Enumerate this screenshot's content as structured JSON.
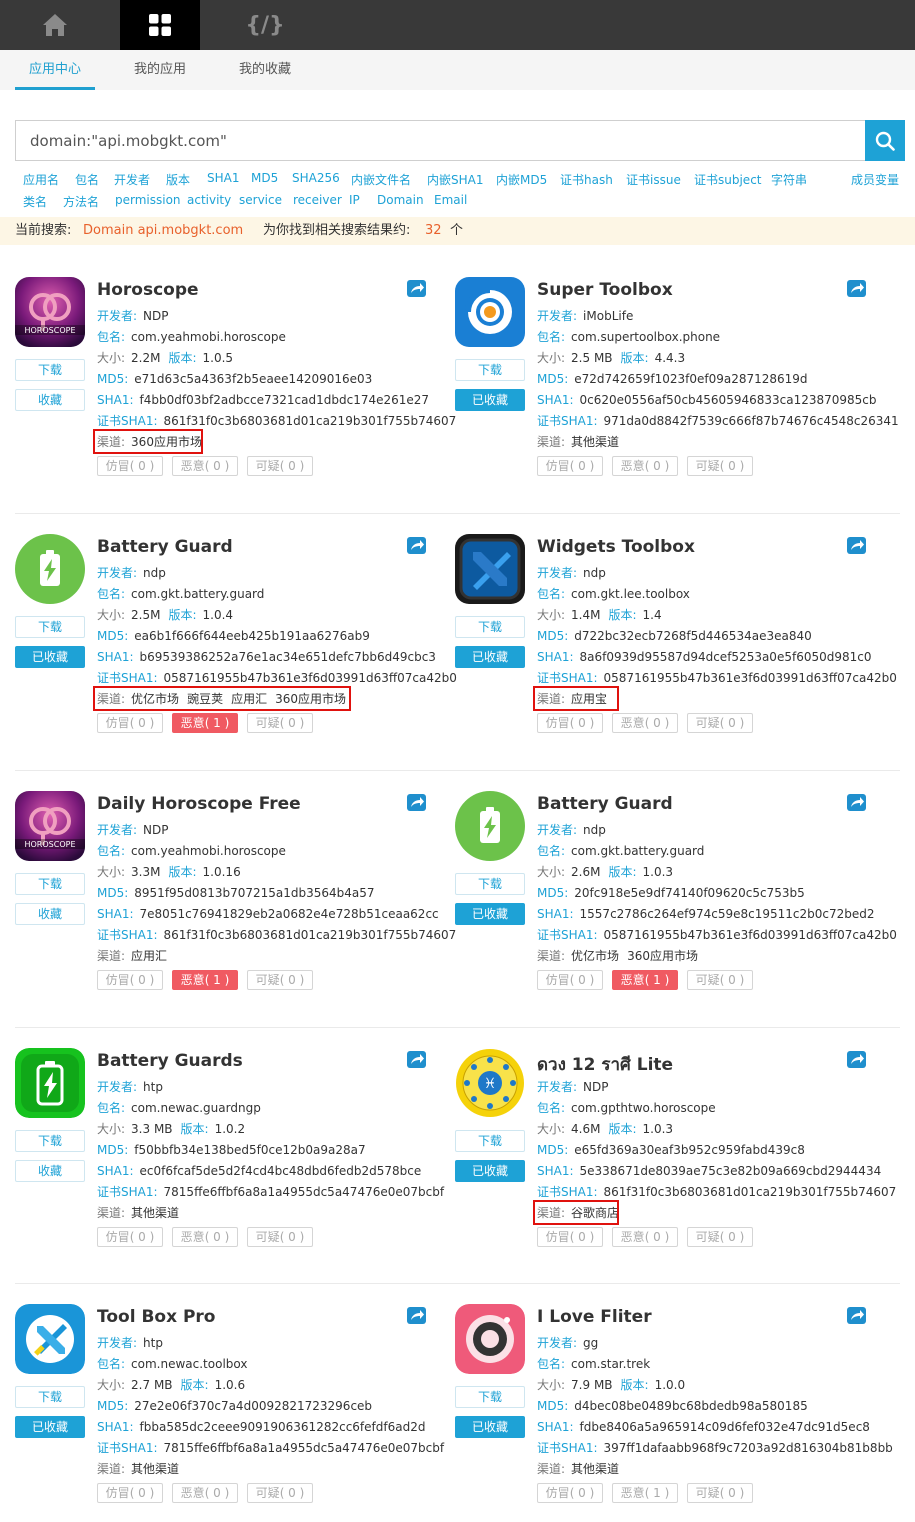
{
  "topbar": {
    "items": [
      {
        "name": "home-icon"
      },
      {
        "name": "grid-icon"
      },
      {
        "name": "code-icon",
        "glyph": "{/}"
      }
    ]
  },
  "tabs": [
    {
      "label": "应用中心",
      "active": true
    },
    {
      "label": "我的应用"
    },
    {
      "label": "我的收藏"
    }
  ],
  "search": {
    "value": "domain:\"api.mobgkt.com\"",
    "button_icon": "search-icon"
  },
  "filters_row1": [
    "应用名",
    "包名",
    "开发者",
    "版本",
    "SHA1",
    "MD5",
    "SHA256",
    "内嵌文件名",
    "内嵌SHA1",
    "内嵌MD5",
    "证书hash",
    "证书issue",
    "证书subject",
    "字符串",
    "成员变量"
  ],
  "filters_row2": [
    "类名",
    "方法名",
    "permission",
    "activity",
    "service",
    "receiver",
    "IP",
    "Domain",
    "Email"
  ],
  "result": {
    "label": "当前搜索:",
    "query": "Domain api.mobgkt.com",
    "text": "为你找到相关搜索结果约:",
    "count": "32",
    "unit": "个"
  },
  "labels": {
    "developer": "开发者:",
    "package": "包名:",
    "size": "大小:",
    "version": "版本:",
    "md5": "MD5:",
    "sha1": "SHA1:",
    "cert_sha1": "证书SHA1:",
    "channel": "渠道:",
    "download": "下载",
    "favorite": "收藏",
    "favorited": "已收藏",
    "rate_fake": "仿冒",
    "rate_malicious": "恶意",
    "rate_suspicious": "可疑"
  },
  "colors": {
    "accent": "#1ea2d6",
    "warning": "#e8612c",
    "danger": "#f05a62",
    "highlight": "#e0120e"
  },
  "apps": [
    {
      "name": "Horoscope",
      "icon": "horoscope-app-icon",
      "developer": "NDP",
      "package": "com.yeahmobi.horoscope",
      "size": "2.2M",
      "version": "1.0.5",
      "md5": "e71d63c5a4363f2b5eaee14209016e03",
      "sha1": "f4bb0df03bf2adbcce7321cad1dbdc174e261e27",
      "cert_sha1": "861f31f0c3b6803681d01ca219b301f755b74607",
      "channels": [
        "360应用市场"
      ],
      "favorited": false,
      "ratings": [
        "( 0 )",
        "( 0 )",
        "( 0 )"
      ],
      "malicious_flag": false,
      "highlight": true
    },
    {
      "name": "Super Toolbox",
      "icon": "super-toolbox-app-icon",
      "developer": "iMobLife",
      "package": "com.supertoolbox.phone",
      "size": "2.5 MB",
      "version": "4.4.3",
      "md5": "e72d742659f1023f0ef09a287128619d",
      "sha1": "0c620e0556af50cb45605946833ca123870985cb",
      "cert_sha1": "971da0d8842f7539c666f87b74676c4548c26341",
      "channels": [
        "其他渠道"
      ],
      "favorited": true,
      "ratings": [
        "( 0 )",
        "( 0 )",
        "( 0 )"
      ],
      "malicious_flag": false,
      "highlight": false
    },
    {
      "name": "Battery Guard",
      "icon": "battery-guard-app-icon",
      "developer": "ndp",
      "package": "com.gkt.battery.guard",
      "size": "2.5M",
      "version": "1.0.4",
      "md5": "ea6b1f666f644eeb425b191aa6276ab9",
      "sha1": "b69539386252a76e1ac34e651defc7bb6d49cbc3",
      "cert_sha1": "0587161955b47b361e3f6d03991d63ff07ca42b0",
      "channels": [
        "优亿市场",
        "豌豆荚",
        "应用汇",
        "360应用市场"
      ],
      "favorited": true,
      "ratings": [
        "( 0 )",
        "( 1 )",
        "( 0 )"
      ],
      "malicious_flag": true,
      "highlight": true
    },
    {
      "name": "Widgets Toolbox",
      "icon": "widgets-toolbox-app-icon",
      "developer": "ndp",
      "package": "com.gkt.lee.toolbox",
      "size": "1.4M",
      "version": "1.4",
      "md5": "d722bc32ecb7268f5d446534ae3ea840",
      "sha1": "8a6f0939d95587d94dcef5253a0e5f6050d981c0",
      "cert_sha1": "0587161955b47b361e3f6d03991d63ff07ca42b0",
      "channels": [
        "应用宝"
      ],
      "favorited": true,
      "ratings": [
        "( 0 )",
        "( 0 )",
        "( 0 )"
      ],
      "malicious_flag": false,
      "highlight": true
    },
    {
      "name": "Daily Horoscope Free",
      "icon": "horoscope-app-icon",
      "developer": "NDP",
      "package": "com.yeahmobi.horoscope",
      "size": "3.3M",
      "version": "1.0.16",
      "md5": "8951f95d0813b707215a1db3564b4a57",
      "sha1": "7e8051c76941829eb2a0682e4e728b51ceaa62cc",
      "cert_sha1": "861f31f0c3b6803681d01ca219b301f755b74607",
      "channels": [
        "应用汇"
      ],
      "favorited": false,
      "ratings": [
        "( 0 )",
        "( 1 )",
        "( 0 )"
      ],
      "malicious_flag": true,
      "highlight": false
    },
    {
      "name": "Battery Guard",
      "icon": "battery-guard-app-icon",
      "developer": "ndp",
      "package": "com.gkt.battery.guard",
      "size": "2.6M",
      "version": "1.0.3",
      "md5": "20fc918e5e9df74140f09620c5c753b5",
      "sha1": "1557c2786c264ef974c59e8c19511c2b0c72bed2",
      "cert_sha1": "0587161955b47b361e3f6d03991d63ff07ca42b0",
      "channels": [
        "优亿市场",
        "360应用市场"
      ],
      "favorited": true,
      "ratings": [
        "( 0 )",
        "( 1 )",
        "( 0 )"
      ],
      "malicious_flag": true,
      "highlight": false
    },
    {
      "name": "Battery Guards",
      "icon": "battery-guards-app-icon",
      "developer": "htp",
      "package": "com.newac.guardngp",
      "size": "3.3 MB",
      "version": "1.0.2",
      "md5": "f50bbfb34e138bed5f0ce12b0a9a28a7",
      "sha1": "ec0f6fcaf5de5d2f4cd4bc48dbd6fedb2d578bce",
      "cert_sha1": "7815ffe6ffbf6a8a1a4955dc5a47476e0e07bcbf",
      "channels": [
        "其他渠道"
      ],
      "favorited": false,
      "ratings": [
        "( 0 )",
        "( 0 )",
        "( 0 )"
      ],
      "malicious_flag": false,
      "highlight": false
    },
    {
      "name": "ดวง 12 ราศี Lite",
      "icon": "zodiac-app-icon",
      "developer": "NDP",
      "package": "com.gpthtwo.horoscope",
      "size": "4.6M",
      "version": "1.0.3",
      "md5": "e65fd369a30eaf3b952c959fabd439c8",
      "sha1": "5e338671de8039ae75c3e82b09a669cbd2944434",
      "cert_sha1": "861f31f0c3b6803681d01ca219b301f755b74607",
      "channels": [
        "谷歌商店"
      ],
      "favorited": true,
      "ratings": [
        "( 0 )",
        "( 0 )",
        "( 0 )"
      ],
      "malicious_flag": false,
      "highlight": true
    },
    {
      "name": "Tool Box Pro",
      "icon": "tool-box-pro-app-icon",
      "developer": "htp",
      "package": "com.newac.toolbox",
      "size": "2.7 MB",
      "version": "1.0.6",
      "md5": "27e2e06f370c7a4d0092821723296ceb",
      "sha1": "fbba585dc2ceee9091906361282cc6fefdf6ad2d",
      "cert_sha1": "7815ffe6ffbf6a8a1a4955dc5a47476e0e07bcbf",
      "channels": [
        "其他渠道"
      ],
      "favorited": true,
      "ratings": [
        "( 0 )",
        "( 0 )",
        "( 0 )"
      ],
      "malicious_flag": false,
      "highlight": false
    },
    {
      "name": "I Love Fliter",
      "icon": "camera-app-icon",
      "developer": "gg",
      "package": "com.star.trek",
      "size": "7.9 MB",
      "version": "1.0.0",
      "md5": "d4bec08be0489bc68bdedb98a580185",
      "sha1": "fdbe8406a5a965914c09d6fef032e47dc91d5ec8",
      "cert_sha1": "397ff1dafaabb968f9c7203a92d816304b81b8bb",
      "channels": [
        "其他渠道"
      ],
      "favorited": true,
      "ratings": [
        "( 0 )",
        "( 1 )",
        "( 0 )"
      ],
      "malicious_flag": false,
      "highlight": false
    }
  ]
}
